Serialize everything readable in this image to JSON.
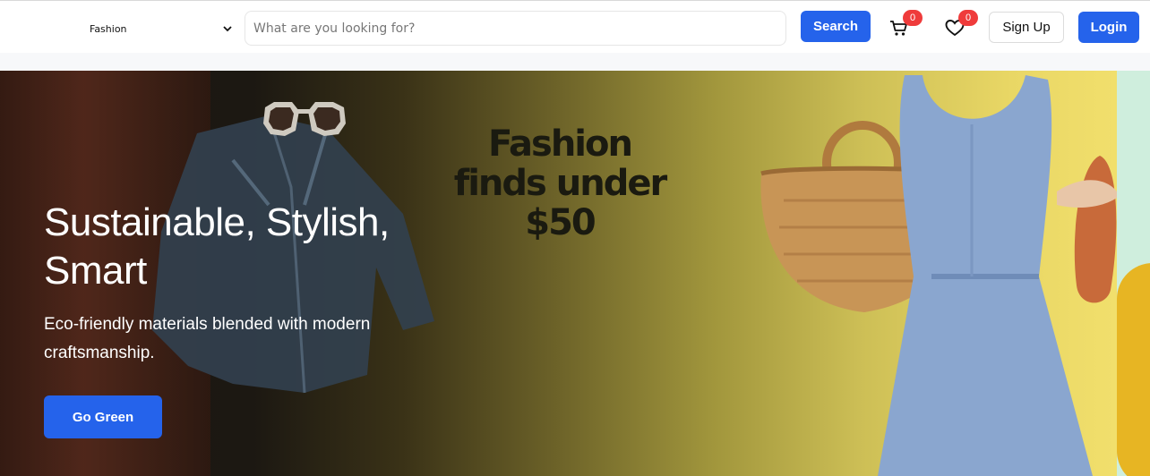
{
  "header": {
    "category_select": {
      "value": "Fashion",
      "icon": "chevron-down-icon"
    },
    "search": {
      "placeholder": "What are you looking for?",
      "button_label": "Search"
    },
    "cart": {
      "icon": "cart-icon",
      "count": "0"
    },
    "wishlist": {
      "icon": "heart-icon",
      "count": "0"
    },
    "signup_label": "Sign Up",
    "login_label": "Login"
  },
  "hero": {
    "title": "Sustainable, Stylish, Smart",
    "subtitle": "Eco-friendly materials blended with modern craftsmanship.",
    "cta_label": "Go Green",
    "promo_text": "Fashion finds under $50"
  },
  "colors": {
    "accent": "#2563eb",
    "badge": "#ef3b3b",
    "banner_yellow": "#f1df6c"
  }
}
